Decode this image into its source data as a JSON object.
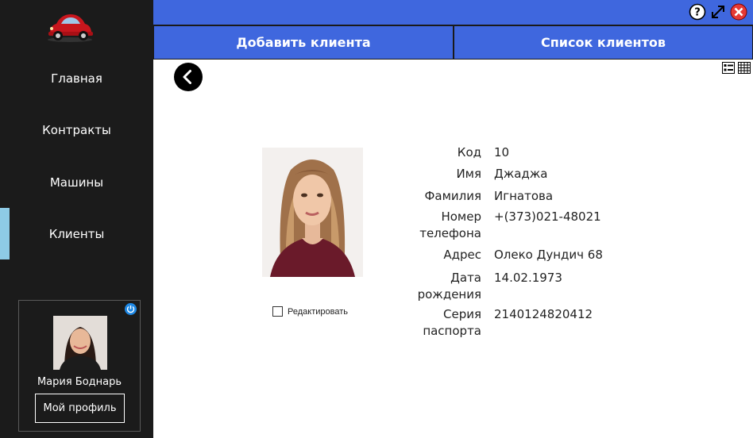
{
  "sidebar": {
    "nav": [
      {
        "label": "Главная"
      },
      {
        "label": "Контракты"
      },
      {
        "label": "Машины"
      },
      {
        "label": "Клиенты"
      }
    ],
    "profile": {
      "name": "Мария Боднарь",
      "button_label": "Мой профиль"
    }
  },
  "tabs": {
    "add_client": "Добавить клиента",
    "client_list": "Список клиентов"
  },
  "details": {
    "edit_label": "Редактировать",
    "fields": [
      {
        "label": "Код",
        "value": "10"
      },
      {
        "label": "Имя",
        "value": "Джаджа"
      },
      {
        "label": "Фамилия",
        "value": "Игнатова"
      },
      {
        "label": "Номер телефона",
        "value": "+(373)021-48021"
      },
      {
        "label": "Адрес",
        "value": "Олеко Дундич 68"
      },
      {
        "label": "Дата рождения",
        "value": "14.02.1973"
      },
      {
        "label": "Серия паспорта",
        "value": "2140124820412"
      }
    ]
  },
  "colors": {
    "accent": "#3f67de",
    "sidebar": "#1b1b1b",
    "active_indicator": "#8ecbe6",
    "close": "#e53935"
  },
  "icons": [
    "car-logo-icon",
    "power-icon",
    "help-icon",
    "maximize-icon",
    "close-icon",
    "back-arrow-icon",
    "detail-view-icon",
    "grid-view-icon"
  ]
}
